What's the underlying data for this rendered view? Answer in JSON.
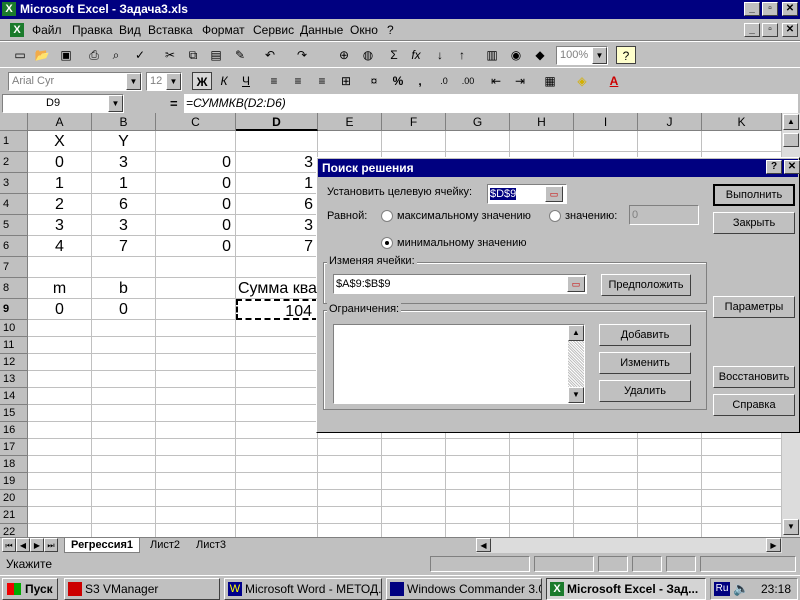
{
  "window": {
    "title": "Microsoft Excel - Задача3.xls",
    "app_icon": "X"
  },
  "window_controls": {
    "minimize": "_",
    "maximize": "▫",
    "close": "✕"
  },
  "menu": [
    "Файл",
    "Правка",
    "Вид",
    "Вставка",
    "Формат",
    "Сервис",
    "Данные",
    "Окно",
    "?"
  ],
  "toolbar": {
    "zoom": "100%",
    "font_name": "Arial Cyr",
    "font_size": "12",
    "bold": "Ж",
    "italic": "К",
    "underline": "Ч",
    "percent": "%",
    "comma": ",",
    "sum": "Σ",
    "fx": "fx"
  },
  "formula_bar": {
    "name_box": "D9",
    "equals": "=",
    "formula": "=СУММКВ(D2:D6)"
  },
  "grid": {
    "columns": [
      "A",
      "B",
      "C",
      "D",
      "E",
      "F",
      "G",
      "H",
      "I",
      "J",
      "K"
    ],
    "rows": [
      "1",
      "2",
      "3",
      "4",
      "5",
      "6",
      "7",
      "8",
      "9",
      "10",
      "11",
      "12",
      "13",
      "14",
      "15",
      "16",
      "17",
      "18",
      "19",
      "20",
      "21",
      "22"
    ],
    "cells": {
      "A1": "X",
      "B1": "Y",
      "A2": "0",
      "B2": "3",
      "C2": "0",
      "D2": "3",
      "A3": "1",
      "B3": "1",
      "C3": "0",
      "D3": "1",
      "A4": "2",
      "B4": "6",
      "C4": "0",
      "D4": "6",
      "A5": "3",
      "B5": "3",
      "C5": "0",
      "D5": "3",
      "A6": "4",
      "B6": "7",
      "C6": "0",
      "D6": "7",
      "A8": "m",
      "B8": "b",
      "D8": "Сумма ква",
      "A9": "0",
      "B9": "0",
      "D9": "104"
    }
  },
  "sheet_tabs": [
    "Регрессия1",
    "Лист2",
    "Лист3"
  ],
  "status": {
    "text": "Укажите"
  },
  "taskbar": {
    "start": "Пуск",
    "tasks": [
      "S3 VManager",
      "Microsoft Word - МЕТОД...",
      "Windows Commander 3.0...",
      "Microsoft Excel - Зад..."
    ],
    "lang": "Ru",
    "clock": "23:18"
  },
  "dialog": {
    "title": "Поиск решения",
    "help": "?",
    "target_label": "Установить целевую ячейку:",
    "target_value": "$D$9",
    "equal_label": "Равной:",
    "opt_max": "максимальному значению",
    "opt_value": "значению:",
    "value_field": "0",
    "opt_min": "минимальному значению",
    "changing_label": "Изменяя ячейки:",
    "changing_value": "$A$9:$B$9",
    "guess_button": "Предположить",
    "constraints_label": "Ограничения:",
    "add_button": "Добавить",
    "change_button": "Изменить",
    "delete_button": "Удалить",
    "solve_button": "Выполнить",
    "close_button": "Закрыть",
    "options_button": "Параметры",
    "reset_button": "Восстановить",
    "help_button": "Справка"
  }
}
